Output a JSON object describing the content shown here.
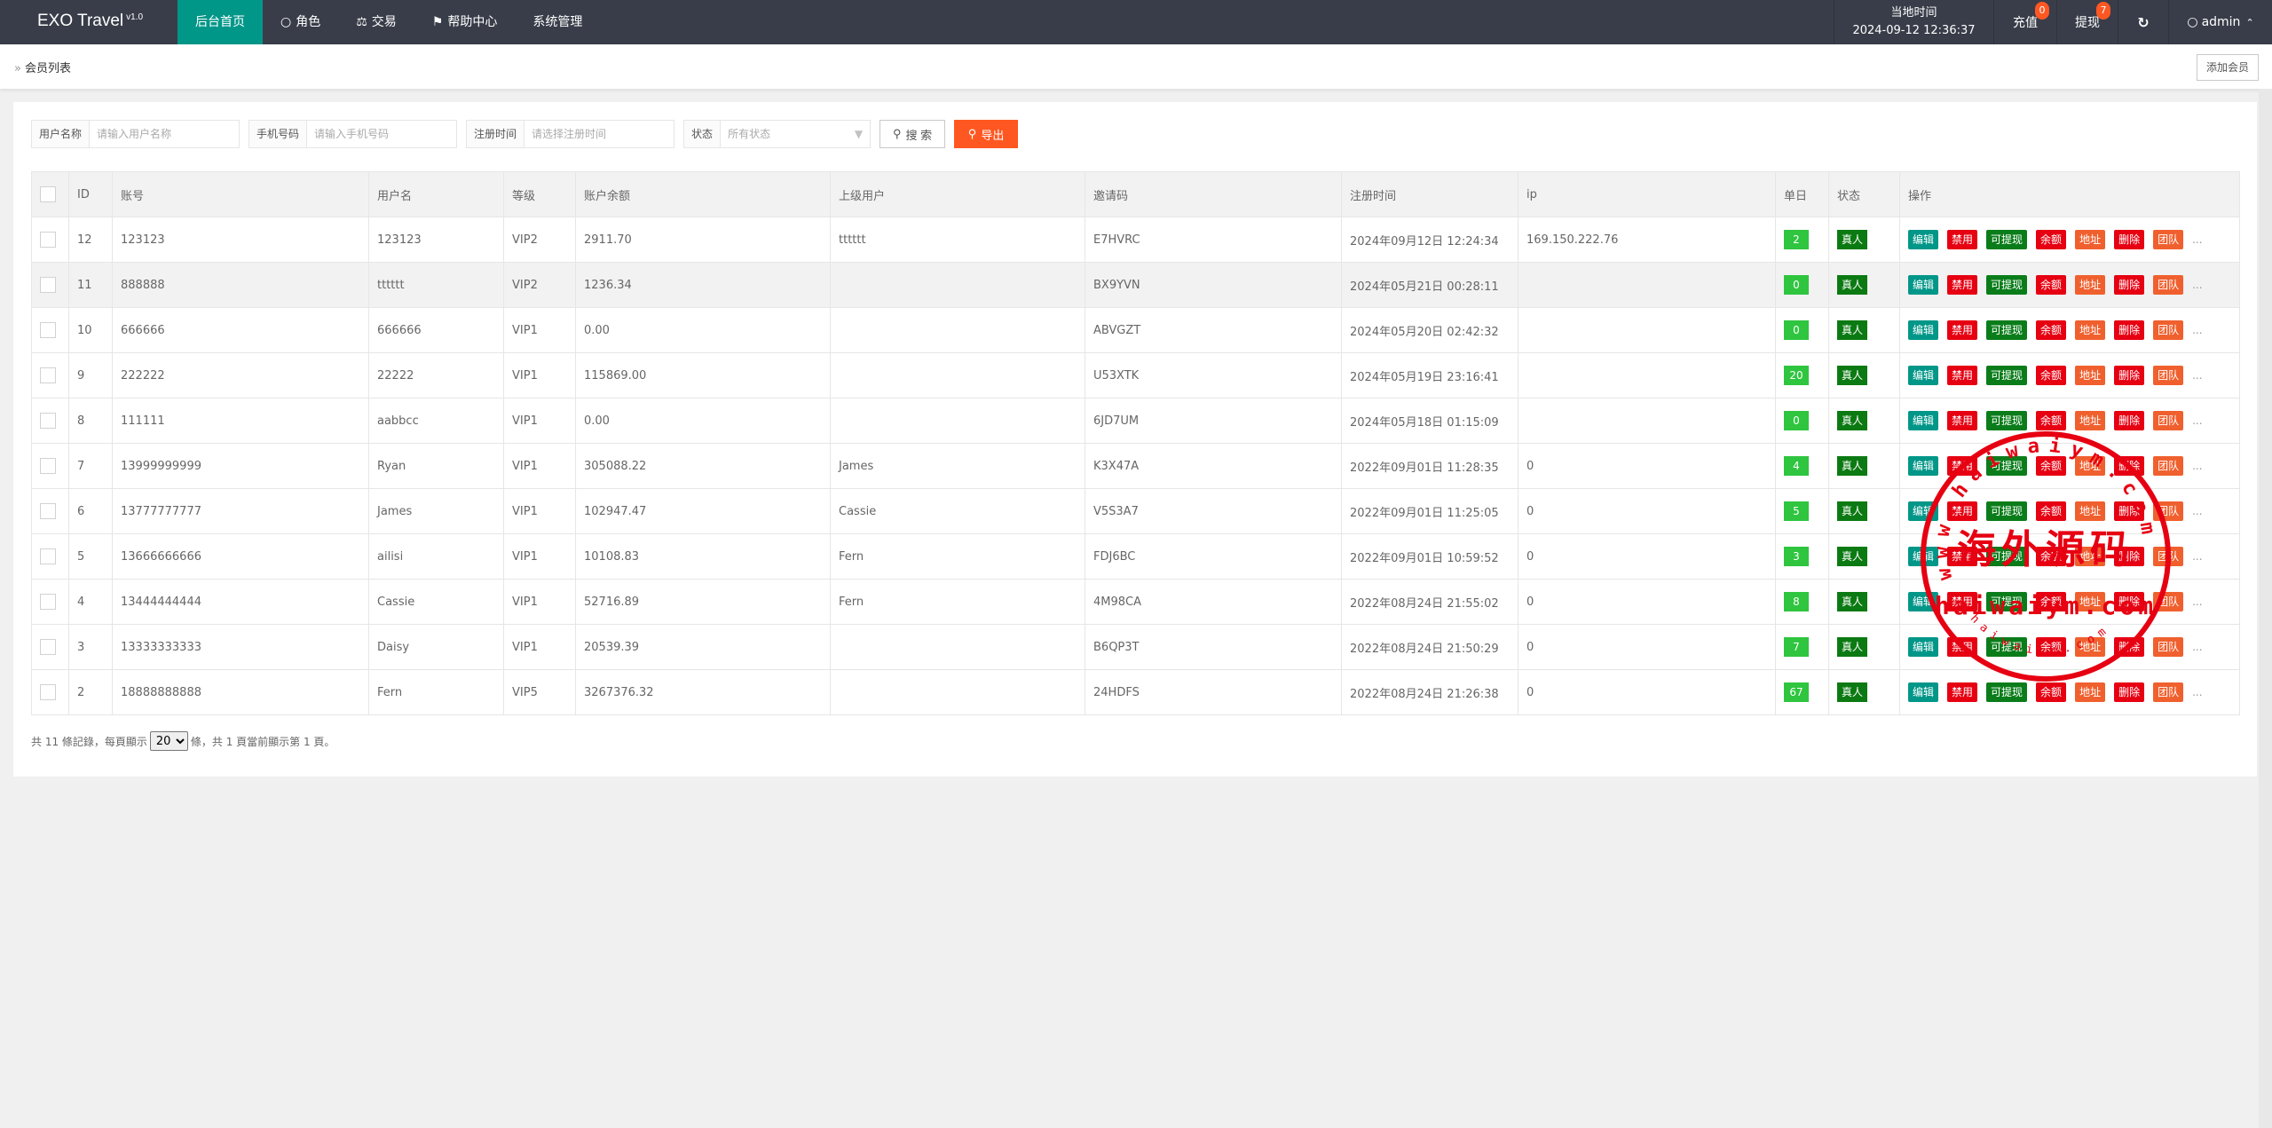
{
  "header": {
    "logo": "EXO Travel",
    "version": "v1.0",
    "nav": [
      {
        "label": "后台首页",
        "icon": "home",
        "active": true
      },
      {
        "label": "角色",
        "icon": "user-icon"
      },
      {
        "label": "交易",
        "icon": "scale-icon"
      },
      {
        "label": "帮助中心",
        "icon": "flag-icon"
      },
      {
        "label": "系统管理",
        "icon": ""
      }
    ],
    "time_label": "当地时间",
    "time_value": "2024-09-12 12:36:37",
    "recharge": {
      "label": "充值",
      "count": "0"
    },
    "withdraw": {
      "label": "提现",
      "count": "7"
    },
    "refresh_icon": "refresh-icon",
    "user": "admin"
  },
  "breadcrumb": {
    "sep": "»",
    "current": "会员列表"
  },
  "add_member_label": "添加会员",
  "filters": {
    "username": {
      "label": "用户名称",
      "placeholder": "请输入用户名称"
    },
    "phone": {
      "label": "手机号码",
      "placeholder": "请输入手机号码"
    },
    "regtime": {
      "label": "注册时间",
      "placeholder": "请选择注册时间"
    },
    "status": {
      "label": "状态",
      "value": "所有状态"
    },
    "search_label": "搜 索",
    "export_label": "导出"
  },
  "table": {
    "columns": [
      "ID",
      "账号",
      "用户名",
      "等级",
      "账户余额",
      "上级用户",
      "邀请码",
      "注册时间",
      "ip",
      "单日",
      "状态",
      "操作"
    ],
    "actions": [
      {
        "label": "编辑",
        "color": "#009688"
      },
      {
        "label": "禁用",
        "color": "#e60012"
      },
      {
        "label": "可提现",
        "color": "#0a7d1a"
      },
      {
        "label": "余额",
        "color": "#e60012"
      },
      {
        "label": "地址",
        "color": "#f0602e"
      },
      {
        "label": "删除",
        "color": "#e60012"
      },
      {
        "label": "团队",
        "color": "#f0602e"
      }
    ],
    "more": "...",
    "rows": [
      {
        "id": "12",
        "account": "123123",
        "username": "123123",
        "level": "VIP2",
        "balance": "2911.70",
        "parent": "tttttt",
        "invite": "E7HVRC",
        "regtime": "2024年09月12日 12:24:34",
        "ip": "169.150.222.76",
        "daily": "2",
        "status": "真人"
      },
      {
        "id": "11",
        "account": "888888",
        "username": "tttttt",
        "level": "VIP2",
        "balance": "1236.34",
        "parent": "",
        "invite": "BX9YVN",
        "regtime": "2024年05月21日 00:28:11",
        "ip": "",
        "daily": "0",
        "status": "真人"
      },
      {
        "id": "10",
        "account": "666666",
        "username": "666666",
        "level": "VIP1",
        "balance": "0.00",
        "parent": "",
        "invite": "ABVGZT",
        "regtime": "2024年05月20日 02:42:32",
        "ip": "",
        "daily": "0",
        "status": "真人"
      },
      {
        "id": "9",
        "account": "222222",
        "username": "22222",
        "level": "VIP1",
        "balance": "115869.00",
        "parent": "",
        "invite": "U53XTK",
        "regtime": "2024年05月19日 23:16:41",
        "ip": "",
        "daily": "20",
        "status": "真人"
      },
      {
        "id": "8",
        "account": "111111",
        "username": "aabbcc",
        "level": "VIP1",
        "balance": "0.00",
        "parent": "",
        "invite": "6JD7UM",
        "regtime": "2024年05月18日 01:15:09",
        "ip": "",
        "daily": "0",
        "status": "真人"
      },
      {
        "id": "7",
        "account": "13999999999",
        "username": "Ryan",
        "level": "VIP1",
        "balance": "305088.22",
        "parent": "James",
        "invite": "K3X47A",
        "regtime": "2022年09月01日 11:28:35",
        "ip": "0",
        "daily": "4",
        "status": "真人"
      },
      {
        "id": "6",
        "account": "13777777777",
        "username": "James",
        "level": "VIP1",
        "balance": "102947.47",
        "parent": "Cassie",
        "invite": "V5S3A7",
        "regtime": "2022年09月01日 11:25:05",
        "ip": "0",
        "daily": "5",
        "status": "真人"
      },
      {
        "id": "5",
        "account": "13666666666",
        "username": "ailisi",
        "level": "VIP1",
        "balance": "10108.83",
        "parent": "Fern",
        "invite": "FDJ6BC",
        "regtime": "2022年09月01日 10:59:52",
        "ip": "0",
        "daily": "3",
        "status": "真人"
      },
      {
        "id": "4",
        "account": "13444444444",
        "username": "Cassie",
        "level": "VIP1",
        "balance": "52716.89",
        "parent": "Fern",
        "invite": "4M98CA",
        "regtime": "2022年08月24日 21:55:02",
        "ip": "0",
        "daily": "8",
        "status": "真人"
      },
      {
        "id": "3",
        "account": "13333333333",
        "username": "Daisy",
        "level": "VIP1",
        "balance": "20539.39",
        "parent": "",
        "invite": "B6QP3T",
        "regtime": "2022年08月24日 21:50:29",
        "ip": "0",
        "daily": "7",
        "status": "真人"
      },
      {
        "id": "2",
        "account": "18888888888",
        "username": "Fern",
        "level": "VIP5",
        "balance": "3267376.32",
        "parent": "",
        "invite": "24HDFS",
        "regtime": "2022年08月24日 21:26:38",
        "ip": "0",
        "daily": "67",
        "status": "真人"
      }
    ]
  },
  "pagination": {
    "prefix": "共 11 條記錄，每頁顯示",
    "per_page": "20",
    "suffix": "條，共 1 頁當前顯示第 1 頁。"
  },
  "watermark": {
    "center": "海外源码",
    "domain": "haiwaiym.com",
    "arc_top": "www.haiwaiym.com",
    "arc_bottom": "haiwaiym.com",
    "color": "#e60012"
  }
}
